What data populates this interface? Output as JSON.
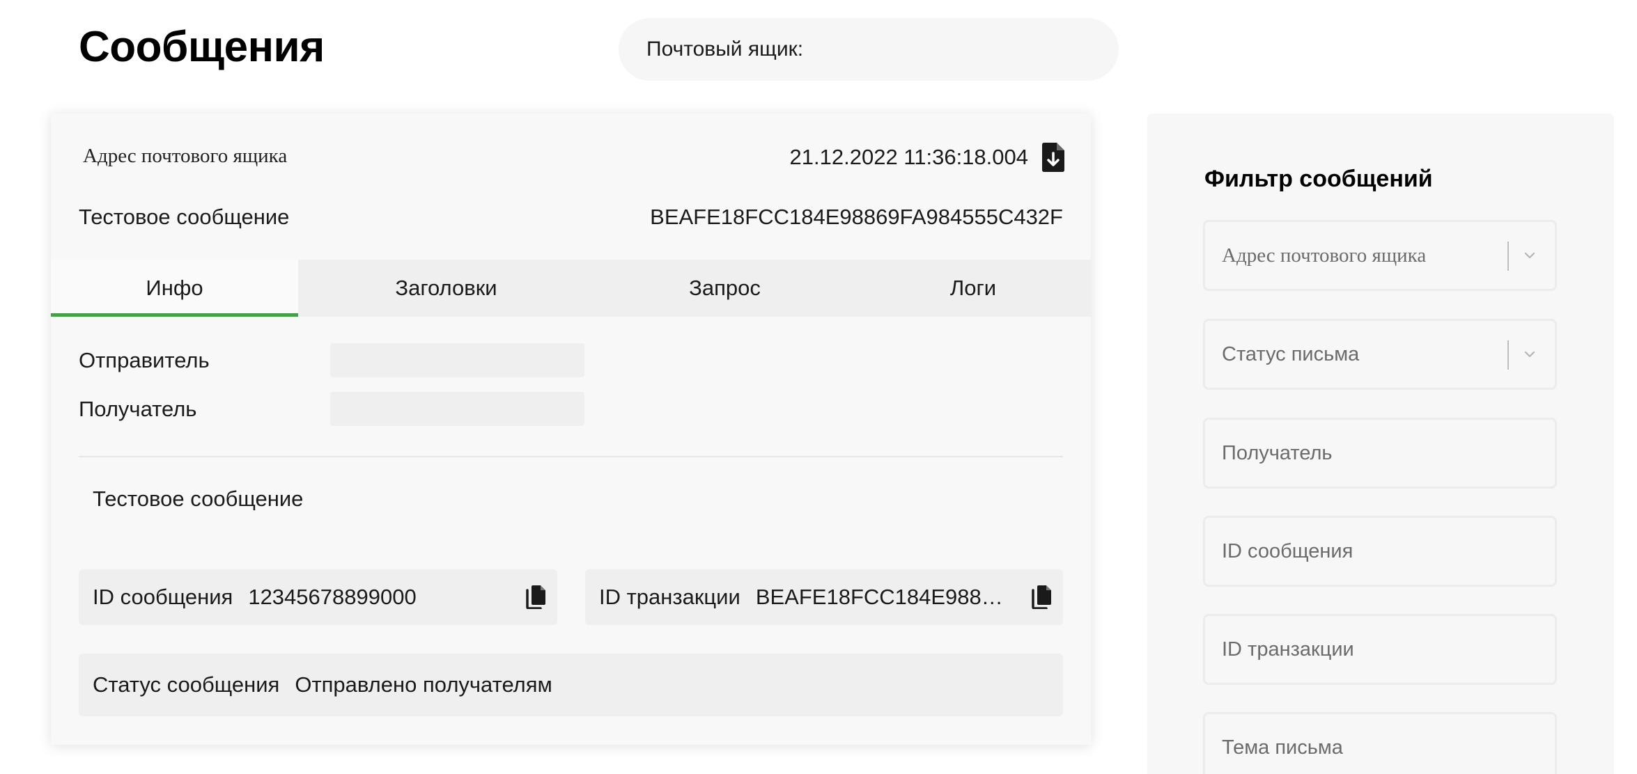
{
  "header": {
    "title": "Сообщения",
    "mailbox_label": "Почтовый ящик:"
  },
  "message": {
    "address": "Адрес почтового ящика",
    "datetime": "21.12.2022 11:36:18.004",
    "subject": "Тестовое сообщение",
    "transaction_id": "BEAFE18FCC184E98869FA984555C432F",
    "tabs": [
      {
        "label": "Инфо",
        "active": true
      },
      {
        "label": "Заголовки",
        "active": false
      },
      {
        "label": "Запрос",
        "active": false
      },
      {
        "label": "Логи",
        "active": false
      }
    ],
    "sender_label": "Отправитель",
    "recipient_label": "Получатель",
    "body": "Тестовое сообщение",
    "message_id_label": "ID сообщения",
    "message_id_value": "12345678899000",
    "transaction_id_label": "ID транзакции",
    "transaction_id_value": "BEAFE18FCC184E9886…",
    "status_label": "Статус сообщения",
    "status_value": "Отправлено получателям"
  },
  "filter": {
    "title": "Фильтр сообщений",
    "fields": [
      {
        "placeholder": "Адрес почтового ящика",
        "type": "select"
      },
      {
        "placeholder": "Статус письма",
        "type": "select"
      },
      {
        "placeholder": "Получатель",
        "type": "input"
      },
      {
        "placeholder": "ID сообщения",
        "type": "input"
      },
      {
        "placeholder": "ID транзакции",
        "type": "input"
      },
      {
        "placeholder": "Тема письма",
        "type": "input"
      }
    ]
  },
  "colors": {
    "accent": "#43a047",
    "card_bg": "#f8f8f8",
    "tab_bar": "#efefef"
  },
  "icons": {
    "download": "file-download-icon",
    "copy": "copy-icon",
    "chevron": "chevron-down-icon"
  }
}
